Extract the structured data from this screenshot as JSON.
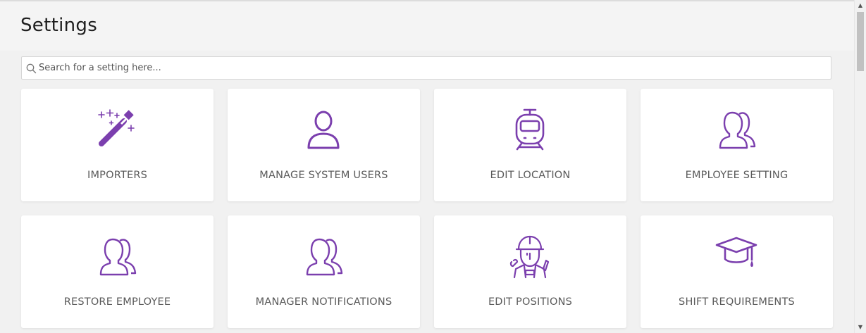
{
  "header": {
    "title": "Settings"
  },
  "search": {
    "placeholder": "Search for a setting here...",
    "value": ""
  },
  "accent_color": "#7b3fae",
  "tiles": [
    {
      "label": "IMPORTERS",
      "icon": "magic-wand-icon"
    },
    {
      "label": "MANAGE SYSTEM USERS",
      "icon": "user-icon"
    },
    {
      "label": "EDIT LOCATION",
      "icon": "train-icon"
    },
    {
      "label": "EMPLOYEE SETTING",
      "icon": "users-icon"
    },
    {
      "label": "RESTORE EMPLOYEE",
      "icon": "users-icon"
    },
    {
      "label": "MANAGER NOTIFICATIONS",
      "icon": "users-icon"
    },
    {
      "label": "EDIT POSITIONS",
      "icon": "worker-icon"
    },
    {
      "label": "SHIFT REQUIREMENTS",
      "icon": "graduation-cap-icon"
    }
  ],
  "scrollbar": {
    "up_arrow": "▲",
    "down_arrow": "▼"
  }
}
